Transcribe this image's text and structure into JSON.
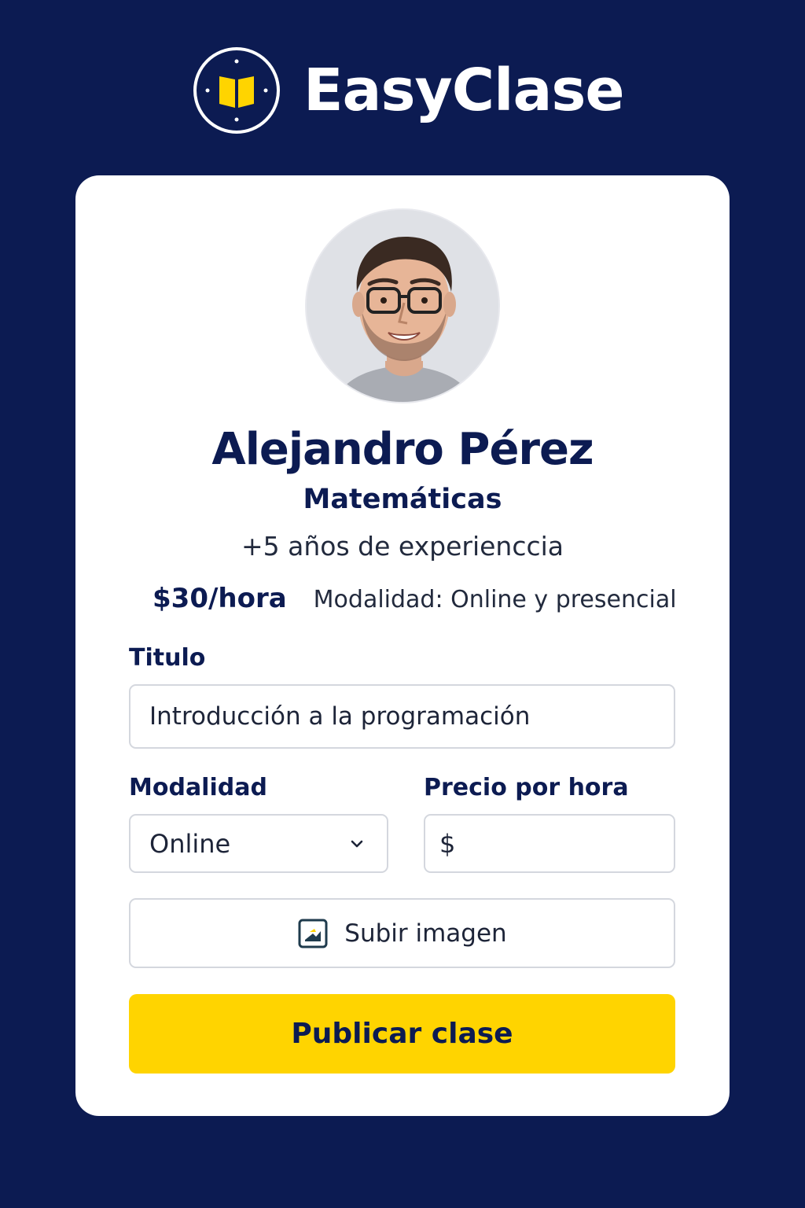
{
  "brand": {
    "name": "EasyClase",
    "logo_icon": "open-book-icon",
    "accent_color": "#ffd400",
    "background_color": "#0c1b52"
  },
  "profile": {
    "name": "Alejandro Pérez",
    "subject": "Matemáticas",
    "experience": "+5 años de experienccia",
    "price": "$30/hora",
    "modality_info": "Modalidad: Online y presencial",
    "avatar_icon": "teacher-portrait"
  },
  "form": {
    "title_label": "Titulo",
    "title_value": "Introducción a la programación",
    "modality_label": "Modalidad",
    "modality_value": "Online",
    "price_label": "Precio por hora",
    "price_prefix": "$",
    "price_value": "",
    "upload_label": "Subir imagen",
    "upload_icon": "image-upload-icon",
    "submit_label": "Publicar clase"
  }
}
